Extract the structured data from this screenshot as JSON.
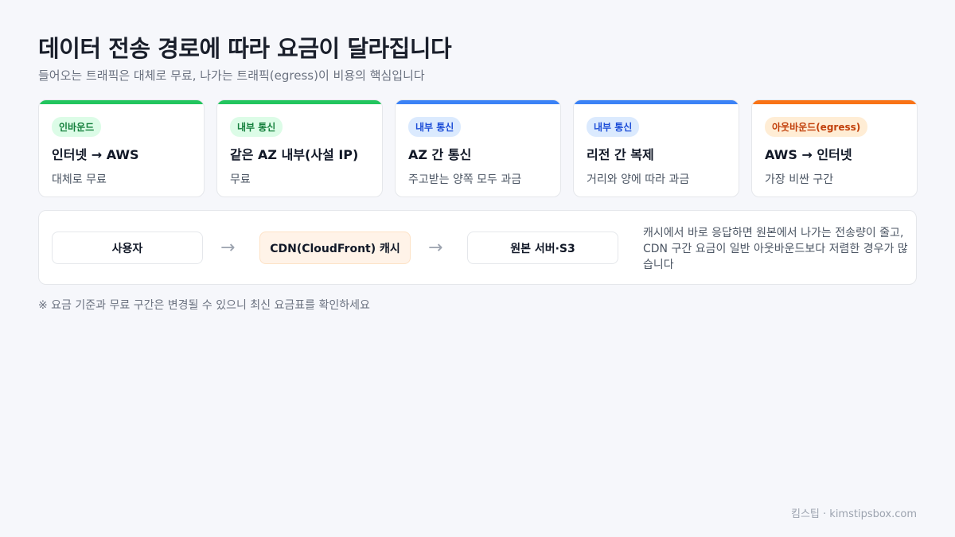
{
  "header": {
    "title": "데이터 전송 경로에 따라 요금이 달라집니다",
    "subtitle": "들어오는 트래픽은 대체로 무료, 나가는 트래픽(egress)이 비용의 핵심입니다"
  },
  "cards": [
    {
      "badge": "인바운드",
      "title": "인터넷 → AWS",
      "desc": "대체로 무료",
      "accent": "#22c55e",
      "badge_bg": "#dcfce7",
      "badge_fg": "#15803d"
    },
    {
      "badge": "내부 통신",
      "title": "같은 AZ 내부(사설 IP)",
      "desc": "무료",
      "accent": "#22c55e",
      "badge_bg": "#dcfce7",
      "badge_fg": "#15803d"
    },
    {
      "badge": "내부 통신",
      "title": "AZ 간 통신",
      "desc": "주고받는 양쪽 모두 과금",
      "accent": "#3b82f6",
      "badge_bg": "#dbeafe",
      "badge_fg": "#1d4ed8"
    },
    {
      "badge": "내부 통신",
      "title": "리전 간 복제",
      "desc": "거리와 양에 따라 과금",
      "accent": "#3b82f6",
      "badge_bg": "#dbeafe",
      "badge_fg": "#1d4ed8"
    },
    {
      "badge": "아웃바운드(egress)",
      "title": "AWS → 인터넷",
      "desc": "가장 비싼 구간",
      "accent": "#f97316",
      "badge_bg": "#ffedd5",
      "badge_fg": "#c2410c"
    }
  ],
  "flow": {
    "nodes": [
      "사용자",
      "CDN(CloudFront) 캐시",
      "원본 서버·S3"
    ],
    "arrow": "→",
    "note": "캐시에서 바로 응답하면 원본에서 나가는 전송량이 줄고, CDN 구간 요금이 일반 아웃바운드보다 저렴한 경우가 많습니다"
  },
  "footnote": "※ 요금 기준과 무료 구간은 변경될 수 있으니 최신 요금표를 확인하세요",
  "footer": "킴스팁 · kimstipsbox.com"
}
